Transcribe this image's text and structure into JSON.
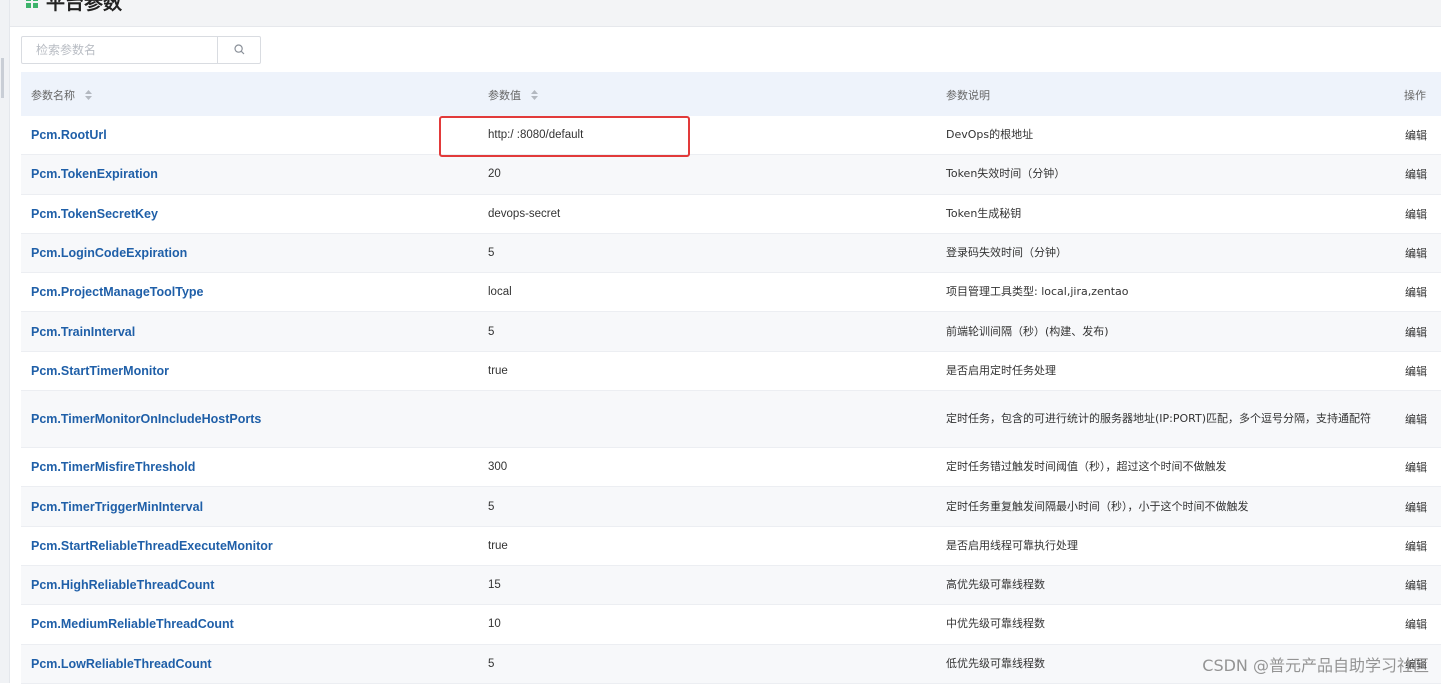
{
  "page": {
    "title": "平台参数"
  },
  "search": {
    "placeholder": "检索参数名",
    "icon": "search-icon"
  },
  "table": {
    "headers": {
      "name": "参数名称",
      "value": "参数值",
      "description": "参数说明",
      "action": "操作"
    },
    "rows": [
      {
        "name": "Pcm.RootUrl",
        "value": "http:/                       :8080/default",
        "description": "DevOps的根地址",
        "action": "编辑"
      },
      {
        "name": "Pcm.TokenExpiration",
        "value": "20",
        "description": "Token失效时间（分钟）",
        "action": "编辑"
      },
      {
        "name": "Pcm.TokenSecretKey",
        "value": "devops-secret",
        "description": "Token生成秘钥",
        "action": "编辑"
      },
      {
        "name": "Pcm.LoginCodeExpiration",
        "value": "5",
        "description": "登录码失效时间（分钟）",
        "action": "编辑"
      },
      {
        "name": "Pcm.ProjectManageToolType",
        "value": "local",
        "description": "项目管理工具类型: local,jira,zentao",
        "action": "编辑"
      },
      {
        "name": "Pcm.TrainInterval",
        "value": "5",
        "description": "前端轮训间隔（秒）(构建、发布)",
        "action": "编辑"
      },
      {
        "name": "Pcm.StartTimerMonitor",
        "value": "true",
        "description": "是否启用定时任务处理",
        "action": "编辑"
      },
      {
        "name": "Pcm.TimerMonitorOnIncludeHostPorts",
        "value": "",
        "description": "定时任务，包含的可进行统计的服务器地址(IP:PORT)匹配，多个逗号分隔，支持通配符",
        "action": "编辑"
      },
      {
        "name": "Pcm.TimerMisfireThreshold",
        "value": "300",
        "description": "定时任务错过触发时间阈值（秒），超过这个时间不做触发",
        "action": "编辑"
      },
      {
        "name": "Pcm.TimerTriggerMinInterval",
        "value": "5",
        "description": "定时任务重复触发间隔最小时间（秒），小于这个时间不做触发",
        "action": "编辑"
      },
      {
        "name": "Pcm.StartReliableThreadExecuteMonitor",
        "value": "true",
        "description": "是否启用线程可靠执行处理",
        "action": "编辑"
      },
      {
        "name": "Pcm.HighReliableThreadCount",
        "value": "15",
        "description": "高优先级可靠线程数",
        "action": "编辑"
      },
      {
        "name": "Pcm.MediumReliableThreadCount",
        "value": "10",
        "description": "中优先级可靠线程数",
        "action": "编辑"
      },
      {
        "name": "Pcm.LowReliableThreadCount",
        "value": "5",
        "description": "低优先级可靠线程数",
        "action": "编辑"
      }
    ]
  },
  "watermark": "CSDN @普元产品自助学习社区",
  "colors": {
    "link": "#1f5fa8",
    "header_bg": "#eef3fb",
    "alt_row_bg": "#f7f8fa",
    "highlight": "#e23a3a",
    "title_icon": "#3db36b"
  }
}
